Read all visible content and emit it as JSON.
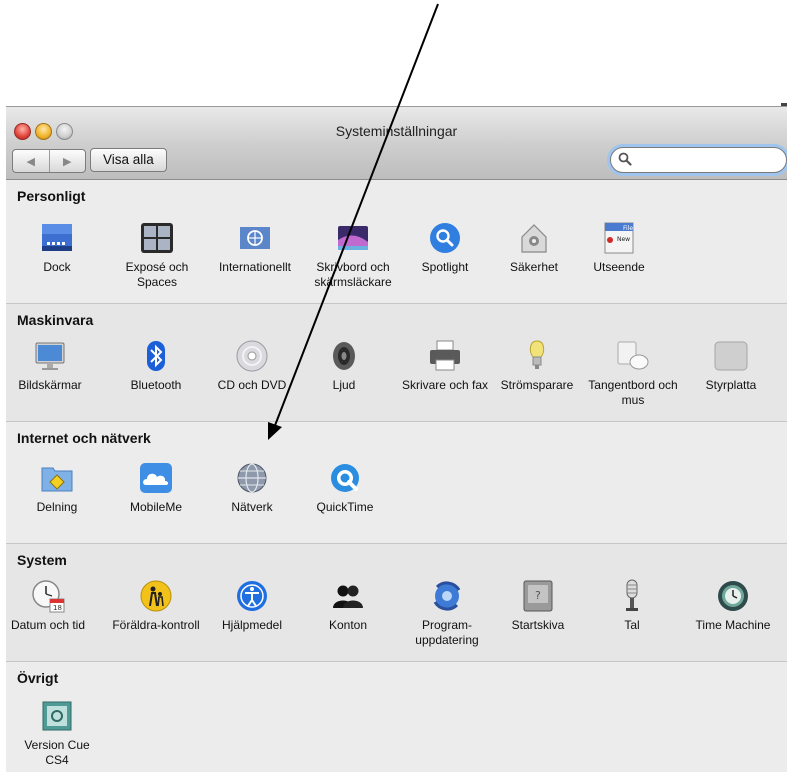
{
  "window": {
    "title": "Systeminställningar",
    "back_label": "◀",
    "forward_label": "▶",
    "show_all": "Visa alla",
    "search_placeholder": ""
  },
  "sections": [
    {
      "title": "Personligt",
      "items": [
        {
          "label": "Dock",
          "icon": "dock-icon"
        },
        {
          "label": "Exposé och Spaces",
          "icon": "expose-icon"
        },
        {
          "label": "Internationellt",
          "icon": "international-icon"
        },
        {
          "label": "Skrivbord och skärmsläckare",
          "icon": "desktop-icon"
        },
        {
          "label": "Spotlight",
          "icon": "spotlight-icon"
        },
        {
          "label": "Säkerhet",
          "icon": "security-icon"
        },
        {
          "label": "Utseende",
          "icon": "appearance-icon"
        }
      ]
    },
    {
      "title": "Maskinvara",
      "items": [
        {
          "label": "Bildskärmar",
          "icon": "display-icon"
        },
        {
          "label": "Bluetooth",
          "icon": "bluetooth-icon"
        },
        {
          "label": "CD och DVD",
          "icon": "cd-dvd-icon"
        },
        {
          "label": "Ljud",
          "icon": "sound-icon"
        },
        {
          "label": "Skrivare och fax",
          "icon": "printer-icon"
        },
        {
          "label": "Strömsparare",
          "icon": "energy-saver-icon"
        },
        {
          "label": "Tangentbord och mus",
          "icon": "keyboard-mouse-icon"
        },
        {
          "label": "Styrplatta",
          "icon": "trackpad-icon"
        }
      ]
    },
    {
      "title": "Internet och nätverk",
      "items": [
        {
          "label": "Delning",
          "icon": "sharing-icon"
        },
        {
          "label": "MobileMe",
          "icon": "mobileme-icon"
        },
        {
          "label": "Nätverk",
          "icon": "network-icon"
        },
        {
          "label": "QuickTime",
          "icon": "quicktime-icon"
        }
      ]
    },
    {
      "title": "System",
      "items": [
        {
          "label": "Datum och tid",
          "icon": "date-time-icon"
        },
        {
          "label": "Föräldra-kontroll",
          "icon": "parental-controls-icon"
        },
        {
          "label": "Hjälpmedel",
          "icon": "accessibility-icon"
        },
        {
          "label": "Konton",
          "icon": "accounts-icon"
        },
        {
          "label": "Program-uppdatering",
          "icon": "software-update-icon"
        },
        {
          "label": "Startskiva",
          "icon": "startup-disk-icon"
        },
        {
          "label": "Tal",
          "icon": "speech-icon"
        },
        {
          "label": "Time Machine",
          "icon": "time-machine-icon"
        }
      ]
    },
    {
      "title": "Övrigt",
      "items": [
        {
          "label": "Version Cue CS4",
          "icon": "version-cue-icon"
        }
      ]
    }
  ],
  "icon_text": {
    "appearance_file": "File",
    "appearance_new": "New",
    "date_day": "18"
  },
  "annotation": {
    "type": "arrow",
    "target": "Nätverk",
    "color": "#000000"
  }
}
